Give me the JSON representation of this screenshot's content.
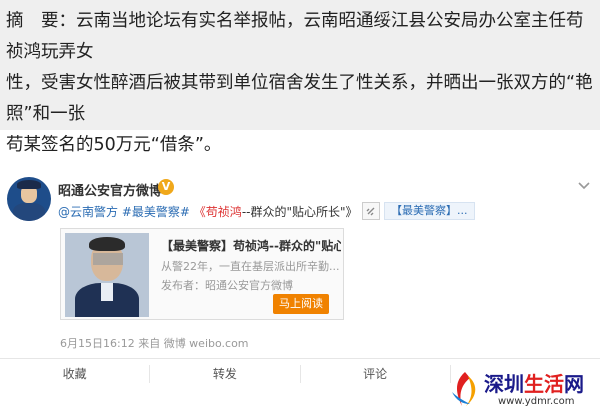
{
  "summary": {
    "label": "摘　要：",
    "line1": "云南当地论坛有实名举报帖，云南昭通绥江县公安局办公室主任苟祯鸿玩弄女",
    "line2": "性，受害女性醉酒后被其带到单位宿舍发生了性关系，并晒出一张双方的“艳照”和一张",
    "line3": "苟某签名的50万元“借条”。"
  },
  "post": {
    "username": "昭通公安官方微博",
    "verified_badge": "V",
    "mention": "@云南警方",
    "hashtag": "#最美警察#",
    "title_link": "《苟祯鸿",
    "title_rest": "--群众的\"贴心所长\"》",
    "tag_label": "【最美警察】...",
    "icons": {
      "more": "chevron-down-icon",
      "tag": "link-icon",
      "verified": "verified-icon"
    },
    "preview": {
      "title": "【最美警察】苟祯鸿--群众的\"贴心...",
      "desc": "从警22年，一直在基层派出所辛勤...",
      "publisher": "发布者：昭通公安官方微博",
      "button": "马上阅读"
    },
    "timestamp": "6月15日16:12 来自 微博 weibo.com",
    "actions": {
      "favorite": "收藏",
      "repost": "转发",
      "comment": "评论",
      "like": ""
    }
  },
  "watermark": {
    "title_part1": "深圳",
    "title_part2": "生活",
    "title_part3": "网",
    "url": "www.ydmr.com"
  },
  "colors": {
    "summary_bg": "#efefef",
    "link_blue": "#2b6cb3",
    "title_red": "#d33333",
    "button_orange": "#f08200"
  }
}
